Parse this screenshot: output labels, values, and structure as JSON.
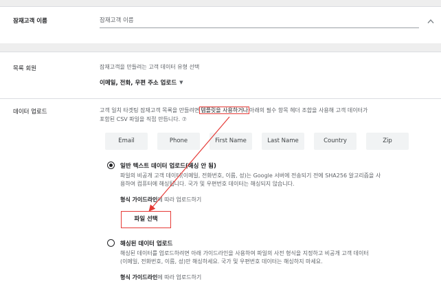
{
  "customer_name": {
    "label": "잠재고객 이름",
    "placeholder": "잠재고객 이름"
  },
  "list_members": {
    "label": "목록 회원",
    "description": "잠재고객을 만들려는 고객 데이터 유형 선택",
    "selected": "이메일, 전화, 우편 주소 업로드"
  },
  "data_upload": {
    "label": "데이터 업로드",
    "desc_before": "고객 일치 타겟팅 잠재고객 목록을 만들려면",
    "desc_highlight": "템플릿을 사용하거나",
    "desc_after": "아래의 필수 항목 헤더 조합을 사용해 고객 데이터가",
    "desc_line2": "포함된 CSV 파일을 직접 만듭니다. ⑦",
    "headers": [
      "Email",
      "Phone",
      "First Name",
      "Last Name",
      "Country",
      "Zip"
    ],
    "option_plain": {
      "title": "일반 텍스트 데이터 업로드(해싱 안 됨)",
      "desc_line1": "파일의 비공개 고객 데이터(이메일, 전화번호, 이름, 성)는 Google 서버에 전송되기 전에 SHA256 알고리즘을 사",
      "desc_line2": "용하여 컴퓨터에 해싱됩니다. 국가 및 우편번호 데이터는 해싱되지 않습니다.",
      "guide_bold": "형식 가이드라인",
      "guide_rest": "에 따라 업로드하기",
      "file_button": "파일 선택"
    },
    "option_hashed": {
      "title": "해싱된 데이터 업로드",
      "desc_line1": "해싱된 데이터를 업로드하려면 아래 가이드라인을 사용하여 파일의 사전 형식을 지정하고 비공개 고객 데이터",
      "desc_line2": "(이메일, 전화번호, 이름, 성)만 해싱하세요. 국가 및 우편번호 데이터는 해싱하지 마세요.",
      "guide_bold": "형식 가이드라인",
      "guide_rest": "에 따라 업로드하기"
    }
  },
  "colors": {
    "annotation": "#e53935",
    "section_gap": "#eeeeee",
    "chip_bg": "#f1f3f4"
  },
  "icons": {
    "collapse": "chevron-up-icon",
    "dropdown": "caret-down-icon",
    "radio_selected": "radio-checked-icon",
    "radio_unselected": "radio-unchecked-icon"
  }
}
